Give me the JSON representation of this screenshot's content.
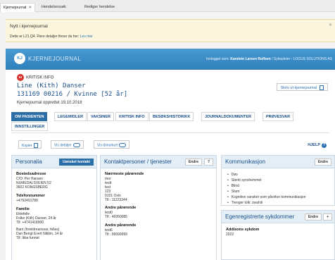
{
  "tabs": [
    {
      "label": "Kjernejournal",
      "close": "✕",
      "active": true
    },
    {
      "label": "Hendelsessøk"
    },
    {
      "label": "Rediger hendelse"
    }
  ],
  "notice": {
    "title": "Nytt i kjernejournal",
    "body": "Dette er L21.Q4. Flere detaljer finner du her:",
    "link": "Les mer",
    "close": "✕"
  },
  "header": {
    "logo_letters": "KJ",
    "logo_text": "KJERNEJOURNAL",
    "logged_in_prefix": "Innlogget som:",
    "user": "Karstein Larsen Rolfsen",
    "role": "/ Sykepleier - LOCUS SOLUTIONS AS"
  },
  "patient": {
    "kritisk_icon": "KI",
    "kritisk": "KRITISK INFO",
    "name": "Line (Kith) Danser",
    "id_line": "131169 00216 / Kvinne [52 år]",
    "created": "Kjernejournal opprettet 19.10.2018",
    "write_button": "Skriv ut kjernejournal"
  },
  "navtabs": [
    "OM PASIENTEN",
    "LEGEMIDLER",
    "VAKSINER",
    "KRITISK INFO",
    "BESØKSHISTORIKK",
    "JOURNALDOKUMENTER",
    "PRØVESVAR",
    "INNSTILLINGER"
  ],
  "toolbar": {
    "copy": "Kopier",
    "details": "Vis detaljer",
    "donor": "Vis donorkort",
    "help": "HJELP",
    "help_icon": "?"
  },
  "personalia": {
    "title": "Personalia",
    "button": "Uønsket kontakt",
    "address_label": "Bostedsadresse",
    "address": [
      "C/O: Per Hansen",
      "NUMEDALSVEIEN 52",
      "3602 KONGSBERG"
    ],
    "phone_label": "Telefonnummer",
    "phone": "+4792491788",
    "family_label": "Familie",
    "family": [
      "Ektefelle",
      "Folke (Kith) Danser, 24 år",
      "Tlf: +4741418900",
      "Barn (foreldreansvar, felles)",
      "Dan Bengt Evert Nikbin, 14 år",
      "Tlf: Ikke funnet"
    ]
  },
  "contacts": {
    "title": "Kontaktpersoner / tjenester",
    "edit": "Endre",
    "help": "?",
    "s1_label": "Nærmeste pårørende",
    "s1": [
      "mor",
      "testt",
      "test",
      "123",
      "0101 Oslo",
      "Tlf.: 11223344"
    ],
    "s2_label": "Andre pårørende",
    "s2": [
      "test0",
      "Tlf.: 46950085"
    ],
    "s3_label": "Andre pårørende",
    "s3": [
      "test6",
      "Tlf.: 99999999"
    ]
  },
  "communication": {
    "title": "Kommunikasjon",
    "edit": "Endre",
    "items": [
      "Døv",
      "Sterkt synshemmet",
      "Blind",
      "Stum",
      "Kognitive vansker som påvirker kommunikasjon",
      "Trenger tolk: zwahili"
    ]
  },
  "selfreg": {
    "title": "Egenregistrerte sykdommer",
    "edit": "Endre",
    "plus": "+",
    "item_label": "Addisons sykdom",
    "item_year": "2022"
  }
}
